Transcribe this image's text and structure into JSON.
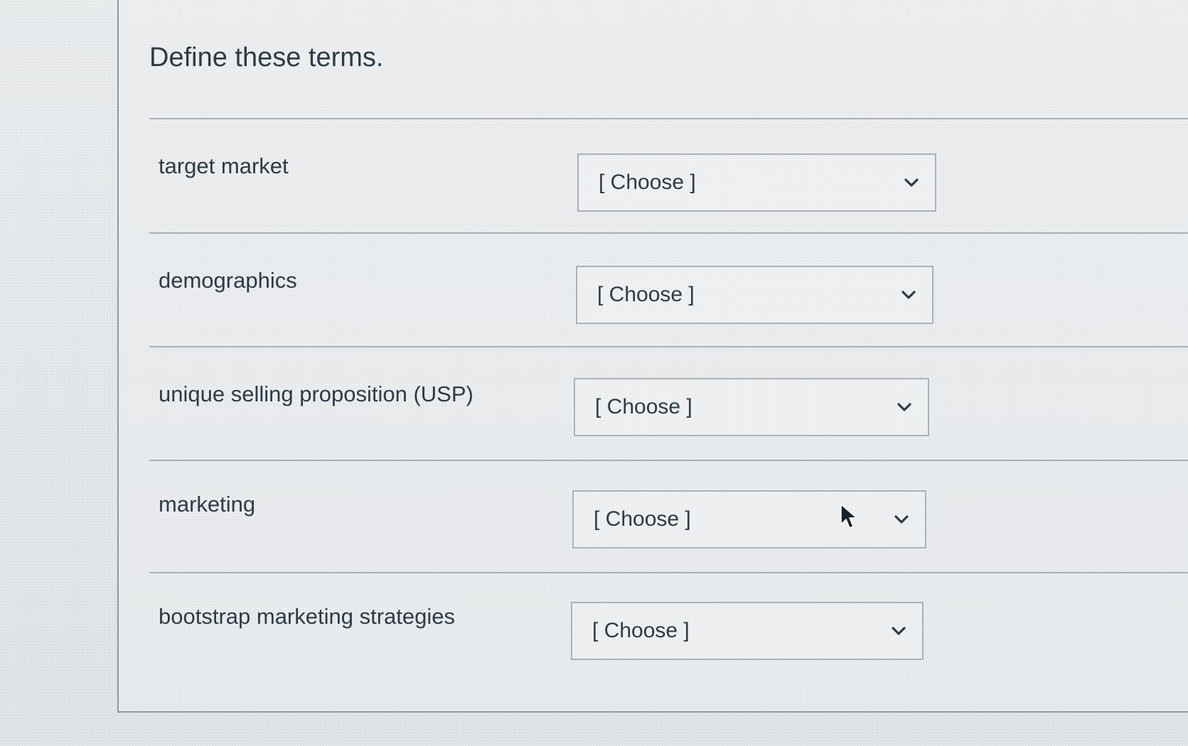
{
  "question": {
    "text": "Define these terms."
  },
  "rows": [
    {
      "term": "target market",
      "selected": "[ Choose ]"
    },
    {
      "term": "demographics",
      "selected": "[ Choose ]"
    },
    {
      "term": "unique selling proposition (USP)",
      "selected": "[ Choose ]"
    },
    {
      "term": "marketing",
      "selected": "[ Choose ]"
    },
    {
      "term": "bootstrap marketing strategies",
      "selected": "[ Choose ]"
    }
  ],
  "icons": {
    "dropdown": "chevron-down-icon",
    "pointer": "mouse-cursor-icon"
  },
  "colors": {
    "text": "#2d3b45",
    "border": "#aab2b8",
    "background": "#e3e6e8"
  }
}
